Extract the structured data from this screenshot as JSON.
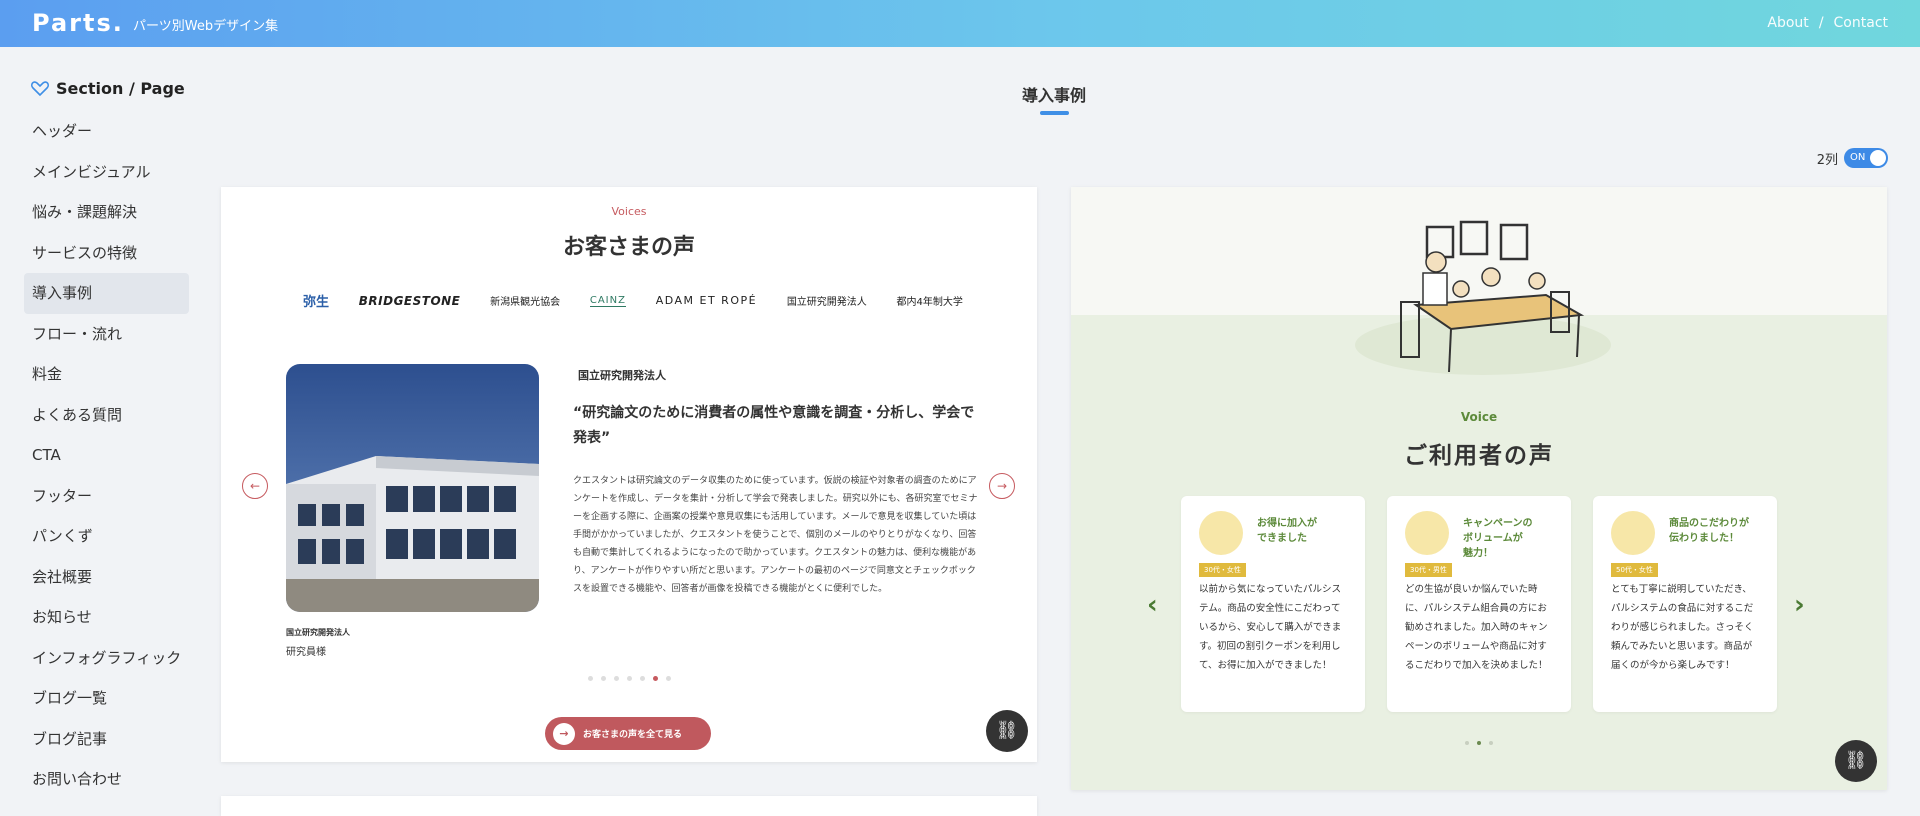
{
  "header": {
    "logo": "Parts.",
    "tagline": "パーツ別Webデザイン集",
    "nav": [
      "About",
      "/",
      "Contact"
    ]
  },
  "sidebar": {
    "heading": "Section / Page",
    "items": [
      {
        "label": "ヘッダー"
      },
      {
        "label": "メインビジュアル"
      },
      {
        "label": "悩み・課題解決"
      },
      {
        "label": "サービスの特徴"
      },
      {
        "label": "導入事例",
        "active": true
      },
      {
        "label": "フロー・流れ"
      },
      {
        "label": "料金"
      },
      {
        "label": "よくある質問"
      },
      {
        "label": "CTA"
      },
      {
        "label": "フッター"
      },
      {
        "label": "パンくず"
      },
      {
        "label": "会社概要"
      },
      {
        "label": "お知らせ"
      },
      {
        "label": "インフォグラフィック"
      },
      {
        "label": "ブログ一覧"
      },
      {
        "label": "ブログ記事"
      },
      {
        "label": "お問い合わせ"
      }
    ]
  },
  "main": {
    "page_title": "導入事例",
    "columns_label": "2列",
    "toggle_label": "ON"
  },
  "card1": {
    "eyebrow": "Voices",
    "title": "お客さまの声",
    "logos": [
      "弥生",
      "BRIDGESTONE",
      "新潟県観光協会",
      "CAINZ",
      "ADAM ET ROPÉ",
      "国立研究開発法人",
      "都内4年制大学"
    ],
    "org": "国立研究開発法人",
    "quote": "“研究論文のために消費者の属性や意識を調査・分析し、学会で発表”",
    "body": "クエスタントは研究論文のデータ収集のために使っています。仮説の検証や対象者の調査のためにアンケートを作成し、データを集計・分析して学会で発表しました。研究以外にも、各研究室でセミナーを企画する際に、企画案の授業や意見収集にも活用しています。メールで意見を収集していた頃は手間がかかっていましたが、クエスタントを使うことで、個別のメールのやりとりがなくなり、回答も自動で集計してくれるようになったので助かっています。クエスタントの魅力は、便利な機能があり、アンケートが作りやすい所だと思います。アンケートの最初のページで同意文とチェックボックスを設置できる機能や、回答者が画像を投稿できる機能がとくに便利でした。",
    "caption_org": "国立研究開発法人",
    "caption_person": "研究員様",
    "cta": "お客さまの声を全て見る",
    "dots_total": 7,
    "dots_active": 5
  },
  "card2": {
    "eyebrow": "Voice",
    "title": "ご利用者の声",
    "voices": [
      {
        "heading": "お得に加入が\nできました",
        "tag": "30代・女性",
        "text": "以前から気になっていたパルシステム。商品の安全性にこだわっているから、安心して購入ができます。初回の割引クーポンを利用して、お得に加入ができました！"
      },
      {
        "heading": "キャンペーンの\nボリュームが\n魅力！",
        "tag": "30代・男性",
        "text": "どの生協が良いか悩んでいた時に、パルシステム組合員の方にお勧めされました。加入時のキャンペーンのボリュームや商品に対するこだわりで加入を決めました！"
      },
      {
        "heading": "商品のこだわりが\n伝わりました！",
        "tag": "50代・女性",
        "text": "とても丁寧に説明していただき、パルシステムの食品に対するこだわりが感じられました。さっそく頼んでみたいと思います。商品が届くのが今から楽しみです！"
      }
    ],
    "dots_total": 3,
    "dots_active": 1
  },
  "icons": {
    "link": "link-icon",
    "prev": "arrow-left-icon",
    "next": "arrow-right-icon"
  }
}
